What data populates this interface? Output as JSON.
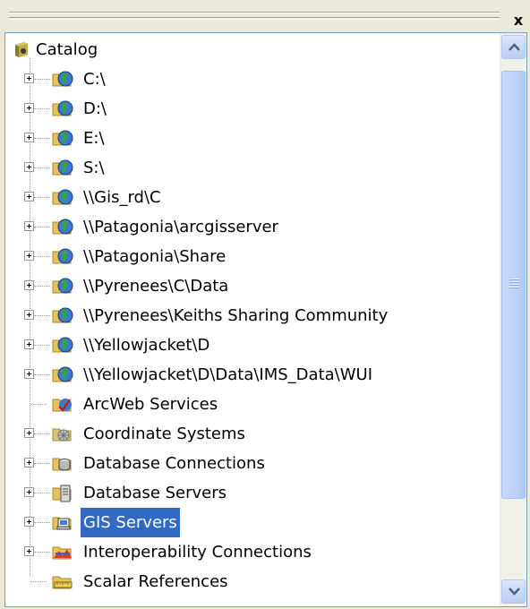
{
  "window": {
    "close_label": "x"
  },
  "tree": {
    "root_label": "Catalog",
    "items": [
      {
        "label": "C:\\",
        "icon": "globe-folder-icon",
        "expandable": true
      },
      {
        "label": "D:\\",
        "icon": "globe-folder-icon",
        "expandable": true
      },
      {
        "label": "E:\\",
        "icon": "globe-folder-icon",
        "expandable": true
      },
      {
        "label": "S:\\",
        "icon": "globe-folder-icon",
        "expandable": true
      },
      {
        "label": "\\\\Gis_rd\\C",
        "icon": "globe-folder-icon",
        "expandable": true
      },
      {
        "label": "\\\\Patagonia\\arcgisserver",
        "icon": "globe-folder-icon",
        "expandable": true
      },
      {
        "label": "\\\\Patagonia\\Share",
        "icon": "globe-folder-icon",
        "expandable": true
      },
      {
        "label": "\\\\Pyrenees\\C\\Data",
        "icon": "globe-folder-icon",
        "expandable": true
      },
      {
        "label": "\\\\Pyrenees\\Keiths Sharing Community",
        "icon": "globe-folder-icon",
        "expandable": true
      },
      {
        "label": "\\\\Yellowjacket\\D",
        "icon": "globe-folder-icon",
        "expandable": true
      },
      {
        "label": "\\\\Yellowjacket\\D\\Data\\IMS_Data\\WUI",
        "icon": "globe-folder-icon",
        "expandable": true
      },
      {
        "label": "ArcWeb Services",
        "icon": "arcweb-services-icon",
        "expandable": false
      },
      {
        "label": "Coordinate Systems",
        "icon": "coordinate-systems-icon",
        "expandable": true
      },
      {
        "label": "Database Connections",
        "icon": "database-connections-icon",
        "expandable": true
      },
      {
        "label": "Database Servers",
        "icon": "database-servers-icon",
        "expandable": true
      },
      {
        "label": "GIS Servers",
        "icon": "gis-servers-icon",
        "expandable": true,
        "selected": true
      },
      {
        "label": "Interoperability Connections",
        "icon": "interoperability-icon",
        "expandable": true
      },
      {
        "label": "Scalar References",
        "icon": "scalar-references-icon",
        "expandable": false
      }
    ]
  },
  "colors": {
    "selection": "#316ac5",
    "panel_border": "#7f9db9",
    "scrollbar_thumb": "#c1d3fb"
  }
}
